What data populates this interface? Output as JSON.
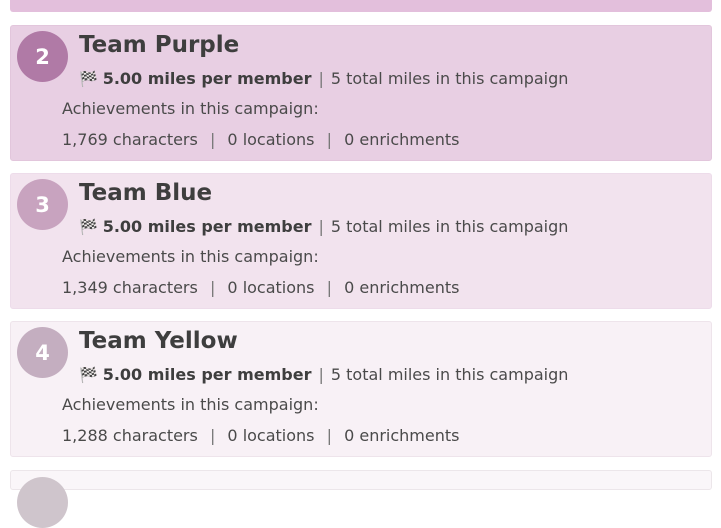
{
  "colors": {
    "rank_2": "#b07aa6",
    "rank_3": "#c8a3bf",
    "rank_4": "#c4aec0",
    "card_2_bg": "#e8cfe3",
    "card_3_bg": "#f2e3ee",
    "card_4_bg": "#f8f1f6"
  },
  "teams": [
    {
      "rank": "2",
      "name": "Team Purple",
      "flag_icon": "🏁",
      "miles_per_member": "5.00 miles per member",
      "separator": "|",
      "total_miles": "5 total miles in this campaign",
      "achievements_label": "Achievements in this campaign:",
      "characters": "1,769 characters",
      "locations": "0 locations",
      "enrichments": "0 enrichments"
    },
    {
      "rank": "3",
      "name": "Team Blue",
      "flag_icon": "🏁",
      "miles_per_member": "5.00 miles per member",
      "separator": "|",
      "total_miles": "5 total miles in this campaign",
      "achievements_label": "Achievements in this campaign:",
      "characters": "1,349 characters",
      "locations": "0 locations",
      "enrichments": "0 enrichments"
    },
    {
      "rank": "4",
      "name": "Team Yellow",
      "flag_icon": "🏁",
      "miles_per_member": "5.00 miles per member",
      "separator": "|",
      "total_miles": "5 total miles in this campaign",
      "achievements_label": "Achievements in this campaign:",
      "characters": "1,288 characters",
      "locations": "0 locations",
      "enrichments": "0 enrichments"
    }
  ]
}
